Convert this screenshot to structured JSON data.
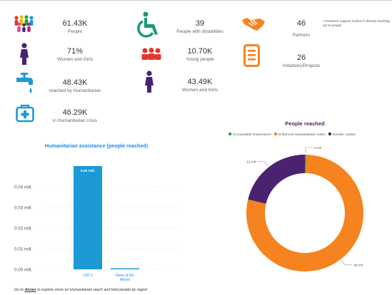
{
  "kpis": {
    "people": {
      "value": "61.43K",
      "label": "People"
    },
    "disabilities": {
      "value": "39",
      "label": "People with disabilities"
    },
    "partners": {
      "value": "46",
      "label": "Partners"
    },
    "women_girls": {
      "value": "71%",
      "label": "Women and Girls"
    },
    "young": {
      "value": "10.70K",
      "label": "Young people"
    },
    "initiatives": {
      "value": "26",
      "label": "Initiatives/Projects"
    },
    "humanitarian": {
      "value": "48.43K",
      "label": "reached by Humanitarian"
    },
    "women_girls_count": {
      "value": "43.49K",
      "label": "Women and Girls"
    },
    "crisis": {
      "value": "46.29K",
      "label": "in Humanitarian crisis"
    }
  },
  "partners_note": "<<Partners support Oxfam in directly reaching out to people",
  "footer": {
    "prefix": "Go to ",
    "link": "Annex",
    "suffix": " to explore more on Humanitarian reach and total people by region"
  },
  "colors": {
    "accent_blue": "#118dff",
    "teal": "#1a9a78",
    "orange": "#f5831f",
    "purple": "#4a2370",
    "magenta": "#b42a78",
    "red": "#e0372d",
    "green": "#2ca02c",
    "pink": "#e8458b",
    "yellow": "#f5b800",
    "sky": "#1c9ad6"
  },
  "chart_data": [
    {
      "type": "bar",
      "title": "Humanitarian assistance (people reached)",
      "categories": [
        "CAT 2",
        "None of the Above"
      ],
      "values": [
        0.05,
        0.0005
      ],
      "data_labels": [
        "0.05 mill.",
        ""
      ],
      "yticks": [
        "0.00 mill.",
        "0.01 mill.",
        "0.02 mill.",
        "0.03 mill.",
        "0.04 mill."
      ],
      "ylim": [
        0,
        0.05
      ],
      "grid": true
    },
    {
      "type": "pie",
      "title": "People reached",
      "legend_position": "top",
      "series": [
        {
          "name": "Accountable Governance",
          "value": 0.2,
          "label": "0 mil",
          "color": "#2ca02c"
        },
        {
          "name": "Enhanced Humanitarian Action",
          "value": 48,
          "label": "48 mil",
          "color": "#f5831f"
        },
        {
          "name": "Gender Justice",
          "value": 13,
          "label": "13 mil",
          "color": "#4a2370"
        }
      ]
    }
  ]
}
